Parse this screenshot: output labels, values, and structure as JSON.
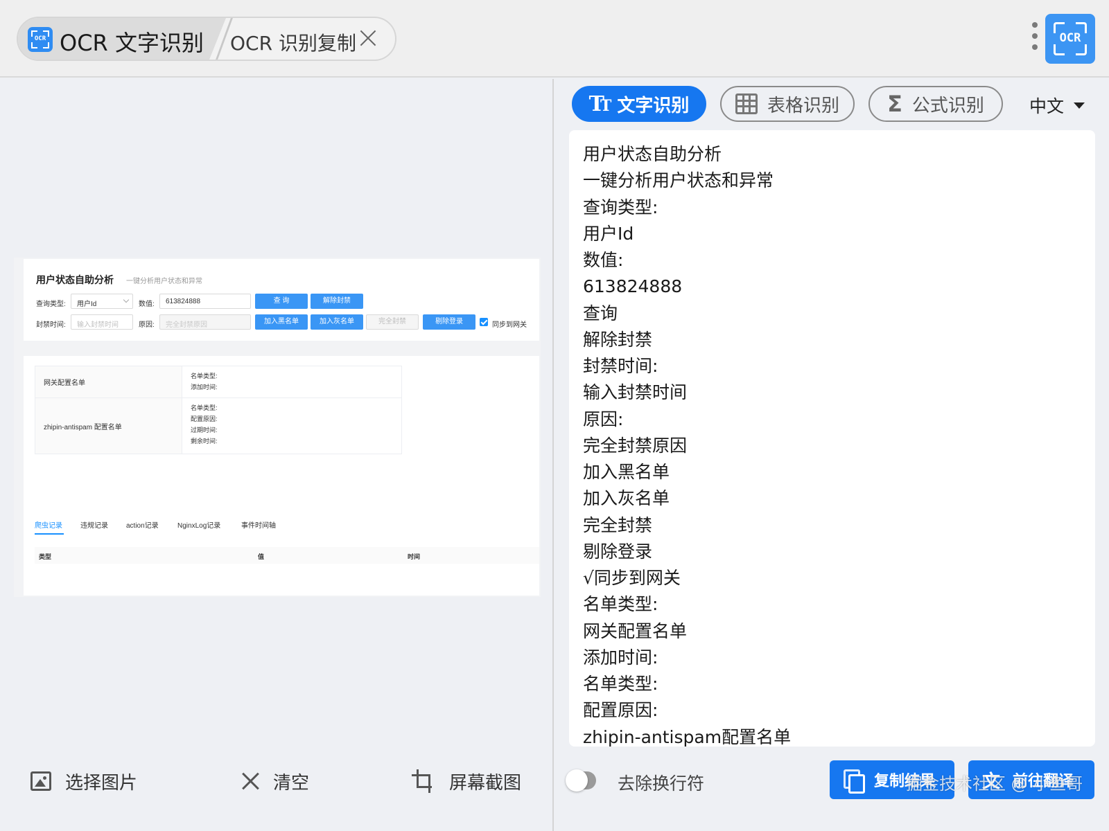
{
  "titlebar": {
    "tab_active_label": "OCR 文字识别",
    "tab_second_label": "OCR 识别复制",
    "logo_text": "OCR"
  },
  "screenshot": {
    "title": "用户状态自助分析",
    "subtitle": "一键分析用户状态和异常",
    "query_type_label": "查询类型:",
    "query_type_value": "用户Id",
    "value_label": "数值:",
    "value": "613824888",
    "btn_query": "查 询",
    "btn_unban": "解除封禁",
    "ban_time_label": "封禁时间:",
    "ban_time_placeholder": "输入封禁时间",
    "reason_label": "原因:",
    "reason_placeholder": "完全封禁原因",
    "btn_blacklist": "加入黑名单",
    "btn_graylist": "加入灰名单",
    "btn_fullban": "完全封禁",
    "btn_kick": "剔除登录",
    "sync_label": "同步到网关",
    "rows": [
      {
        "name": "网关配置名单",
        "fields": [
          "名单类型:",
          "添加时间:"
        ]
      },
      {
        "name": "zhipin-antispam 配置名单",
        "fields": [
          "名单类型:",
          "配置原因:",
          "过期时间:",
          "剩余时间:"
        ]
      }
    ],
    "tabs": [
      "爬虫记录",
      "违规记录",
      "action记录",
      "NginxLog记录",
      "事件时间轴"
    ],
    "columns": [
      "类型",
      "值",
      "时间"
    ]
  },
  "left_actions": {
    "select_image": "选择图片",
    "clear": "清空",
    "screenshot": "屏幕截图"
  },
  "modes": {
    "text": "文字识别",
    "table": "表格识别",
    "formula": "公式识别",
    "language": "中文"
  },
  "result_lines": [
    "用户状态自助分析",
    "一键分析用户状态和异常",
    "查询类型:",
    "用户Id",
    "数值:",
    "613824888",
    "查询",
    "解除封禁",
    "封禁时间:",
    "输入封禁时间",
    "原因:",
    "完全封禁原因",
    "加入黑名单",
    "加入灰名单",
    "完全封禁",
    "剔除登录",
    "√同步到网关",
    "名单类型:",
    "网关配置名单",
    "添加时间:",
    "名单类型:",
    "配置原因:",
    "zhipin-antispam配置名单"
  ],
  "bottom": {
    "toggle_label": "去除换行符",
    "copy_button": "复制结果",
    "translate_button": "前往翻译",
    "watermark": "掘金技术社区 @ 小鱼哥"
  },
  "colors": {
    "accent": "#1677f0",
    "logo": "#3c95f3"
  }
}
